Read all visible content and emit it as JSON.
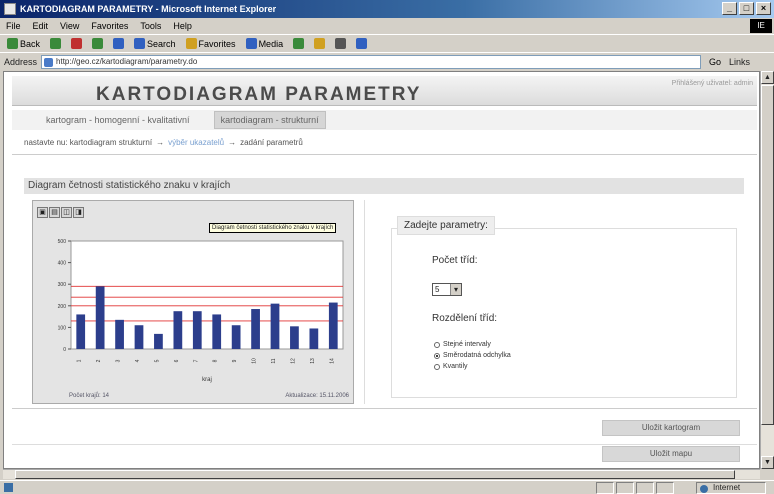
{
  "window": {
    "title": "KARTODIAGRAM PARAMETRY - Microsoft Internet Explorer",
    "buttons": [
      "_",
      "□",
      "×"
    ]
  },
  "menubar": {
    "items": [
      "File",
      "Edit",
      "View",
      "Favorites",
      "Tools",
      "Help"
    ],
    "logo": "IE"
  },
  "toolbar": {
    "items": [
      {
        "label": "Back",
        "icon": "back-arrow-icon",
        "color": "#3a8a3a"
      },
      {
        "label": "",
        "icon": "forward-arrow-icon",
        "color": "#3a8a3a"
      },
      {
        "label": "",
        "icon": "stop-icon",
        "color": "#c03030"
      },
      {
        "label": "",
        "icon": "refresh-icon",
        "color": "#3a8a3a"
      },
      {
        "label": "",
        "icon": "home-icon",
        "color": "#3060c0"
      },
      {
        "label": "Search",
        "icon": "search-icon",
        "color": "#3060c0"
      },
      {
        "label": "Favorites",
        "icon": "star-icon",
        "color": "#d0a020"
      },
      {
        "label": "Media",
        "icon": "media-icon",
        "color": "#3060c0"
      },
      {
        "label": "",
        "icon": "history-icon",
        "color": "#3a8a3a"
      },
      {
        "label": "",
        "icon": "mail-icon",
        "color": "#d0a020"
      },
      {
        "label": "",
        "icon": "print-icon",
        "color": "#555555"
      },
      {
        "label": "",
        "icon": "edit-icon",
        "color": "#3060c0"
      }
    ]
  },
  "address": {
    "label": "Address",
    "value": "http://geo.cz/kartodiagram/parametry.do",
    "go": "Go",
    "links": "Links"
  },
  "page": {
    "title": "KARTODIAGRAM PARAMETRY",
    "user_info": "Přihlášený uživatel: admin",
    "tabs": [
      {
        "label": "kartogram - homogenní - kvalitativní",
        "active": false
      },
      {
        "label": "kartodiagram - strukturní",
        "active": true
      }
    ],
    "breadcrumb": [
      {
        "text": "nastavte nu: kartodiagram strukturní",
        "link": false
      },
      {
        "text": "→",
        "link": false
      },
      {
        "text": "výběr ukazatelů",
        "link": true
      },
      {
        "text": "→",
        "link": false
      },
      {
        "text": "zadání parametrů",
        "link": false
      }
    ],
    "section_title": "Diagram četnosti statistického znaku v krajích",
    "params": {
      "heading": "Zadejte parametry:",
      "count_label": "Počet tříd:",
      "count_value": "5",
      "division_label": "Rozdělení tříd:",
      "options": [
        {
          "label": "Stejné intervaly",
          "checked": false
        },
        {
          "label": "Směrodatná odchylka",
          "checked": true
        },
        {
          "label": "Kvantily",
          "checked": false
        }
      ]
    },
    "buttons": {
      "primary": "Uložit kartogram",
      "secondary": "Uložit mapu"
    }
  },
  "chart_tools": [
    "▣",
    "▤",
    "◫",
    "◨"
  ],
  "tooltip": "Diagram četnosti statistického znaku v krajích",
  "chart_footer_left": "Počet krajů: 14",
  "chart_footer_right": "Aktualizace: 15.11.2006",
  "status": {
    "zone": "Internet"
  },
  "chart_data": {
    "type": "bar",
    "categories": [
      "1",
      "2",
      "3",
      "4",
      "5",
      "6",
      "7",
      "8",
      "9",
      "10",
      "11",
      "12",
      "13",
      "14"
    ],
    "values": [
      160,
      290,
      135,
      110,
      70,
      175,
      175,
      160,
      110,
      185,
      210,
      105,
      95,
      215
    ],
    "xlabel": "kraj",
    "ylabel": "",
    "ylim": [
      0,
      500
    ],
    "yticks": [
      0,
      100,
      200,
      300,
      400,
      500
    ],
    "reference_lines": [
      130,
      200,
      240,
      290
    ],
    "bar_color": "#2c3e8c",
    "line_color": "#e03030"
  }
}
